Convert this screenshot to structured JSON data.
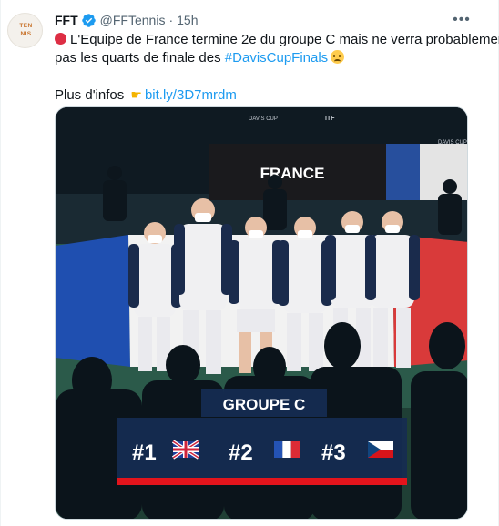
{
  "tweet": {
    "author": {
      "name": "FFT",
      "handle": "@FFTennis",
      "verified": true,
      "avatar_text_top": "TEN",
      "avatar_text_bottom": "NIS"
    },
    "time": "15h",
    "more_label": "•••",
    "text": {
      "line1": "L'Equipe de France termine 2e du groupe C mais ne verra probablement",
      "line2_prefix": "pas les quarts de finale des ",
      "hashtag": "#DavisCupFinals",
      "line3_prefix": "Plus d'infos ",
      "url": "bit.ly/3D7mrdm"
    },
    "icons": {
      "status": "red-circle-icon",
      "emoji": "sad-face-icon",
      "pointer": "pointing-hand-icon"
    },
    "media": {
      "board_text": "FRANCE",
      "sponsor_1": "DAVIS CUP",
      "sponsor_2": "ITF",
      "sponsor_3": "DAVIS CUP",
      "group_title": "GROUPE C",
      "ranks": [
        {
          "label": "#1",
          "flag": "uk-flag-icon"
        },
        {
          "label": "#2",
          "flag": "france-flag-icon"
        },
        {
          "label": "#3",
          "flag": "czech-flag-icon"
        }
      ]
    },
    "colors": {
      "link": "#1d9bf0",
      "muted": "#536471",
      "verified": "#1d9bf0",
      "banner_red": "#e3141c",
      "banner_navy": "#152c52"
    }
  }
}
